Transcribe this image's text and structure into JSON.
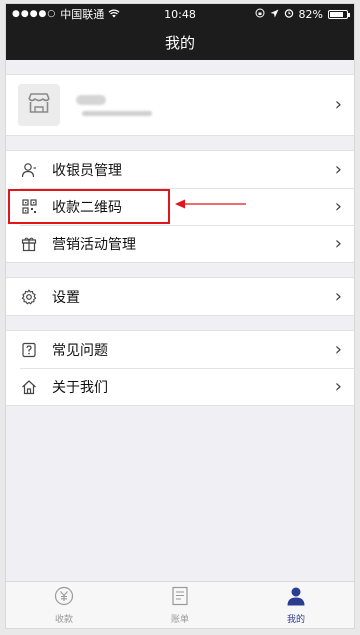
{
  "status_bar": {
    "carrier": "中国联通",
    "time": "10:48",
    "battery": "82%"
  },
  "nav": {
    "title": "我的"
  },
  "menu": {
    "group1": [
      {
        "label": "收银员管理",
        "icon": "cashier-user-icon"
      },
      {
        "label": "收款二维码",
        "icon": "qr-code-icon"
      },
      {
        "label": "营销活动管理",
        "icon": "gift-box-icon"
      }
    ],
    "group2": [
      {
        "label": "设置",
        "icon": "gear-icon"
      }
    ],
    "group3": [
      {
        "label": "常见问题",
        "icon": "question-icon"
      },
      {
        "label": "关于我们",
        "icon": "home-icon"
      }
    ]
  },
  "tabs": [
    {
      "label": "收款",
      "icon": "yuan-coin-icon",
      "active": false
    },
    {
      "label": "账单",
      "icon": "bill-icon",
      "active": false
    },
    {
      "label": "我的",
      "icon": "user-icon",
      "active": true
    }
  ],
  "colors": {
    "highlight": "#e0161b",
    "active_tab": "#2a3d8f",
    "header_bg": "#1c1c1c"
  }
}
